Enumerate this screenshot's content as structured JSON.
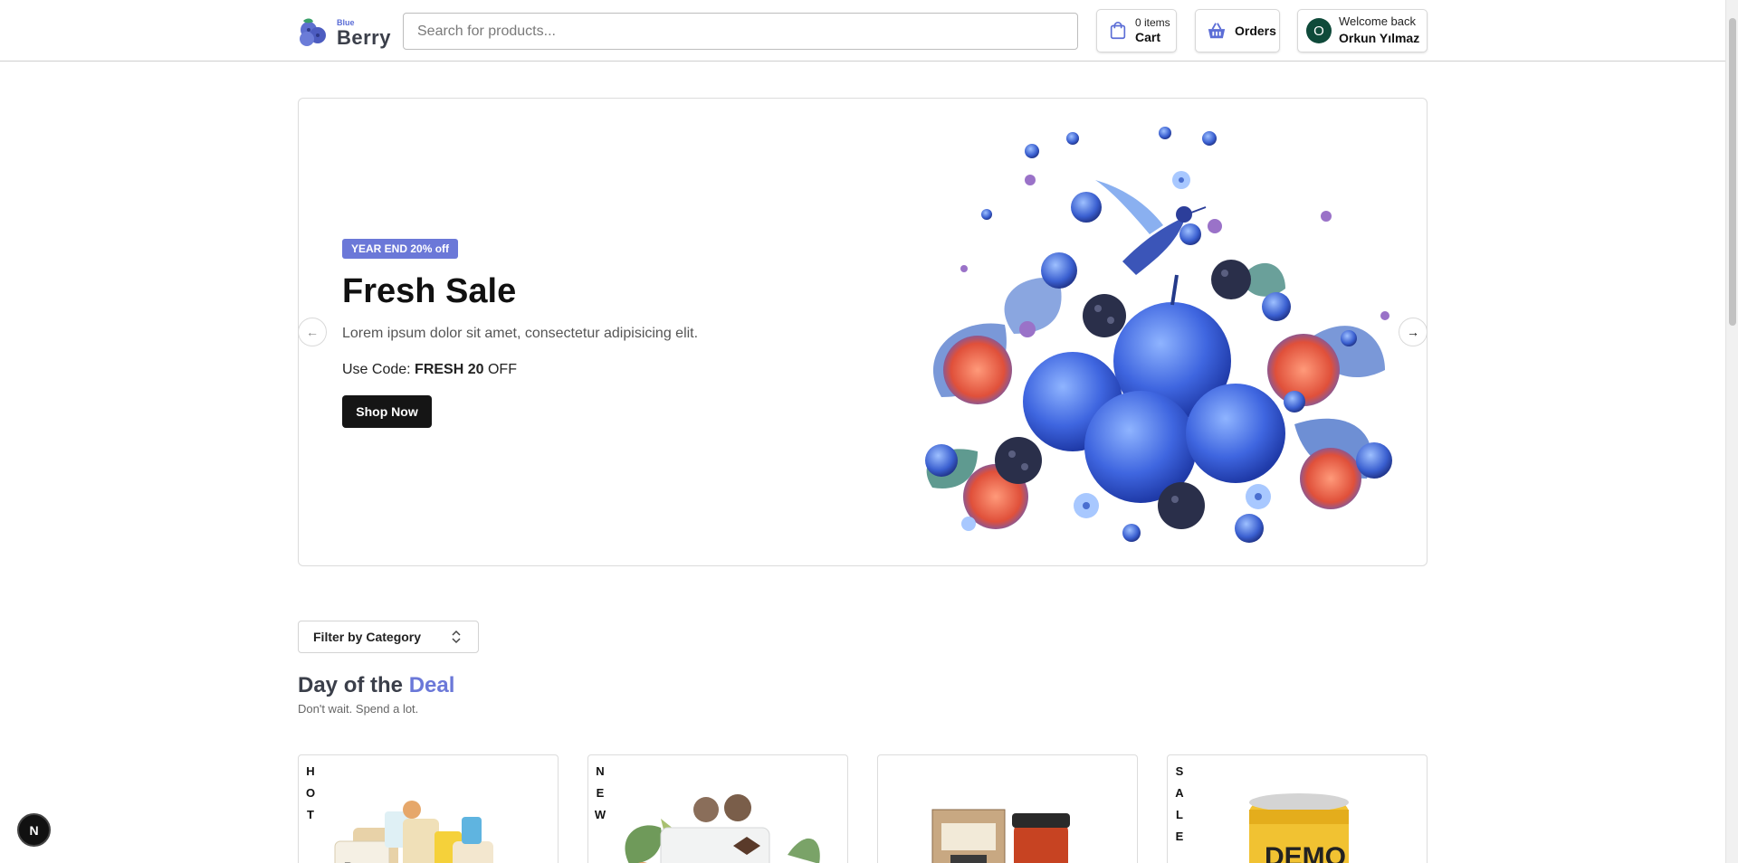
{
  "header": {
    "logo_small": "Blue",
    "logo_big": "Berry",
    "search_placeholder": "Search for products...",
    "cart": {
      "count": "0 items",
      "label": "Cart"
    },
    "orders": {
      "label": "Orders"
    },
    "user": {
      "initial": "O",
      "welcome": "Welcome back",
      "name": "Orkun Yılmaz"
    }
  },
  "hero": {
    "badge": "YEAR END 20% off",
    "title": "Fresh Sale",
    "description": "Lorem ipsum dolor sit amet, consectetur adipisicing elit.",
    "code_prefix": "Use Code:",
    "code": "FRESH 20",
    "code_suffix": "OFF",
    "button": "Shop Now",
    "prev_icon": "arrow-left-icon",
    "next_icon": "arrow-right-icon"
  },
  "filter": {
    "label": "Filter by Category"
  },
  "deal": {
    "title_main": "Day of the",
    "title_accent": "Deal",
    "subtitle": "Don't wait. Spend a lot."
  },
  "cards": [
    {
      "tag": [
        "H",
        "O",
        "T"
      ]
    },
    {
      "tag": [
        "N",
        "E",
        "W"
      ]
    },
    {
      "tag": []
    },
    {
      "tag": [
        "S",
        "A",
        "L",
        "E"
      ]
    }
  ],
  "dev_badge": "N",
  "colors": {
    "accent": "#6b78d8",
    "dark": "#151515",
    "avatar": "#0f4a3a"
  }
}
